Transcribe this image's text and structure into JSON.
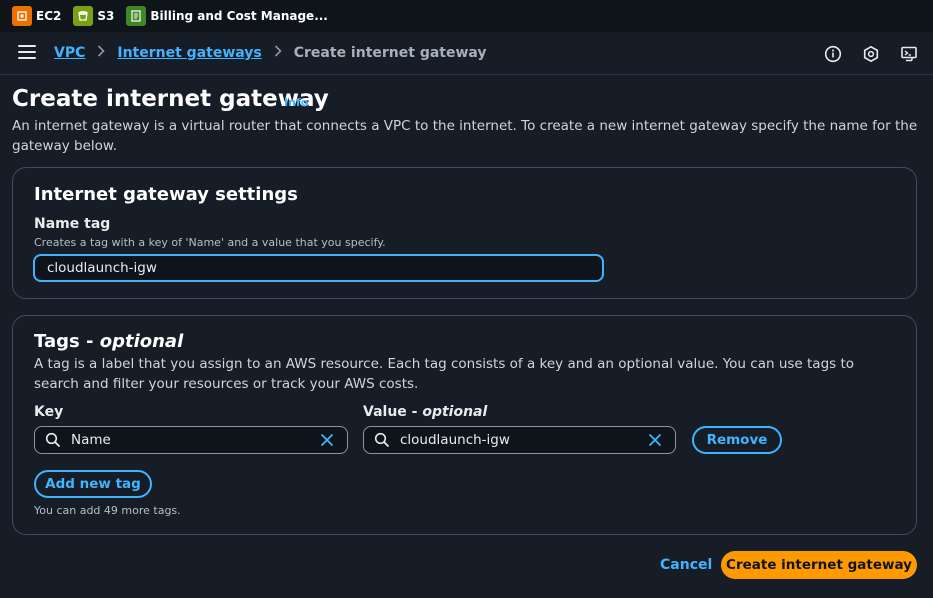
{
  "favorites": [
    {
      "label": "EC2",
      "icon": "ec2-icon",
      "color": "#ed7100"
    },
    {
      "label": "S3",
      "icon": "s3-icon",
      "color": "#7aa116"
    },
    {
      "label": "Billing and Cost Manage...",
      "icon": "billing-icon",
      "color": "#3f8624"
    }
  ],
  "breadcrumb": {
    "items": [
      "VPC",
      "Internet gateways"
    ],
    "current": "Create internet gateway"
  },
  "header_icons": [
    "info-circle-icon",
    "notifications-hexagon-icon",
    "cloudshell-icon"
  ],
  "page": {
    "title": "Create internet gateway",
    "info": "Info",
    "description": "An internet gateway is a virtual router that connects a VPC to the internet. To create a new internet gateway specify the name for the gateway below."
  },
  "settings": {
    "title": "Internet gateway settings",
    "name_tag_label": "Name tag",
    "name_tag_hint": "Creates a tag with a key of 'Name' and a value that you specify.",
    "name_tag_value": "cloudlaunch-igw"
  },
  "tags": {
    "title_main": "Tags - ",
    "title_optional": "optional",
    "description": "A tag is a label that you assign to an AWS resource. Each tag consists of a key and an optional value. You can use tags to search and filter your resources or track your AWS costs.",
    "key_label": "Key",
    "value_label_main": "Value - ",
    "value_label_optional": "optional",
    "rows": [
      {
        "key": "Name",
        "value": "cloudlaunch-igw"
      }
    ],
    "remove_label": "Remove",
    "add_label": "Add new tag",
    "limit_hint": "You can add 49 more tags."
  },
  "footer": {
    "cancel_label": "Cancel",
    "submit_label": "Create internet gateway"
  },
  "colors": {
    "link": "#42b4ff",
    "primary": "#ff9900",
    "background": "#161d26"
  }
}
